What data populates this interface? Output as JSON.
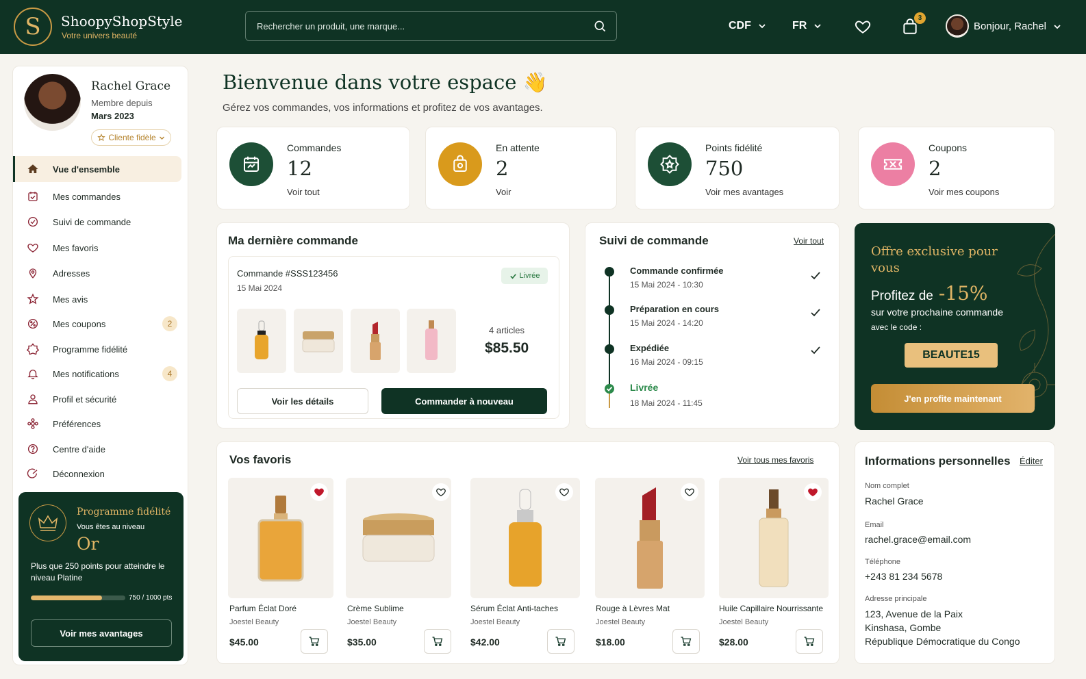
{
  "header": {
    "brand_initial": "S",
    "brand_name": "ShoopyShopStyle",
    "brand_tagline": "Votre univers beauté",
    "search_placeholder": "Rechercher un produit, une marque...",
    "currency": "CDF",
    "language": "FR",
    "cart_count": "3",
    "greeting": "Bonjour, Rachel"
  },
  "sidebar": {
    "profile": {
      "name": "Rachel Grace",
      "member_since_label": "Membre depuis",
      "member_since_date": "Mars 2023",
      "badge": "Cliente fidèle"
    },
    "items": [
      {
        "label": "Vue d'ensemble",
        "icon": "home-icon"
      },
      {
        "label": "Mes commandes",
        "icon": "orders-icon"
      },
      {
        "label": "Suivi de commande",
        "icon": "tracking-icon"
      },
      {
        "label": "Mes favoris",
        "icon": "heart-icon"
      },
      {
        "label": "Adresses",
        "icon": "location-icon"
      },
      {
        "label": "Mes avis",
        "icon": "star-icon"
      },
      {
        "label": "Mes coupons",
        "icon": "coupon-icon",
        "badge": "2"
      },
      {
        "label": "Programme fidélité",
        "icon": "loyalty-icon"
      },
      {
        "label": "Mes notifications",
        "icon": "bell-icon",
        "badge": "4"
      },
      {
        "label": "Profil et sécurité",
        "icon": "user-icon"
      },
      {
        "label": "Préférences",
        "icon": "settings-icon"
      },
      {
        "label": "Centre d'aide",
        "icon": "help-icon"
      },
      {
        "label": "Déconnexion",
        "icon": "logout-icon"
      }
    ],
    "loyalty": {
      "title": "Programme fidélité",
      "subtitle": "Vous êtes au niveau",
      "level": "Or",
      "description": "Plus que 250 points pour atteindre le niveau Platine",
      "points_text": "750 / 1000 pts",
      "progress_fraction": 0.75,
      "button": "Voir mes avantages"
    }
  },
  "main": {
    "welcome_title": "Bienvenue dans votre espace",
    "welcome_emoji": "👋",
    "welcome_subtitle": "Gérez vos commandes, vos informations et profitez de vos avantages.",
    "stats": [
      {
        "label": "Commandes",
        "value": "12",
        "link": "Voir tout",
        "color": "#1d4f36"
      },
      {
        "label": "En attente",
        "value": "2",
        "link": "Voir",
        "color": "#d99a1c"
      },
      {
        "label": "Points fidélité",
        "value": "750",
        "link": "Voir mes avantages",
        "color": "#1d4f36"
      },
      {
        "label": "Coupons",
        "value": "2",
        "link": "Voir mes coupons",
        "color": "#ec7fa3"
      }
    ],
    "last_order": {
      "title": "Ma dernière commande",
      "order_number": "Commande #SSS123456",
      "date": "15 Mai 2024",
      "status": "Livrée",
      "articles": "4 articles",
      "total": "$85.50",
      "details_button": "Voir les détails",
      "reorder_button": "Commander à nouveau"
    },
    "tracking": {
      "title": "Suivi de commande",
      "link": "Voir tout",
      "steps": [
        {
          "title": "Commande confirmée",
          "time": "15 Mai 2024 - 10:30"
        },
        {
          "title": "Préparation en cours",
          "time": "15 Mai 2024 - 14:20"
        },
        {
          "title": "Expédiée",
          "time": "16 Mai 2024 - 09:15"
        },
        {
          "title": "Livrée",
          "time": "18 Mai 2024 - 11:45"
        }
      ]
    },
    "offer": {
      "title": "Offre exclusive pour vous",
      "profit_label": "Profitez de",
      "discount": "-15%",
      "subtitle": "sur votre prochaine commande",
      "code_label": "avec le code :",
      "code": "BEAUTE15",
      "button": "J'en profite maintenant"
    },
    "favorites": {
      "title": "Vos favoris",
      "link": "Voir tous mes favoris",
      "items": [
        {
          "name": "Parfum Éclat Doré",
          "brand": "Joestel Beauty",
          "price": "$45.00",
          "liked": true
        },
        {
          "name": "Crème Sublime",
          "brand": "Joestel Beauty",
          "price": "$35.00",
          "liked": false
        },
        {
          "name": "Sérum Éclat Anti-taches",
          "brand": "Joestel Beauty",
          "price": "$42.00",
          "liked": false
        },
        {
          "name": "Rouge à Lèvres Mat",
          "brand": "Joestel Beauty",
          "price": "$18.00",
          "liked": false
        },
        {
          "name": "Huile Capillaire Nourrissante",
          "brand": "Joestel Beauty",
          "price": "$28.00",
          "liked": true
        }
      ]
    },
    "personal_info": {
      "title": "Informations personnelles",
      "edit": "Éditer",
      "full_name_label": "Nom complet",
      "full_name": "Rachel Grace",
      "email_label": "Email",
      "email": "rachel.grace@email.com",
      "phone_label": "Téléphone",
      "phone": "+243 81 234 5678",
      "address_label": "Adresse principale",
      "address_line1": "123, Avenue de la Paix",
      "address_line2": "Kinshasa, Gombe",
      "address_line3": "République Démocratique du Congo"
    }
  }
}
